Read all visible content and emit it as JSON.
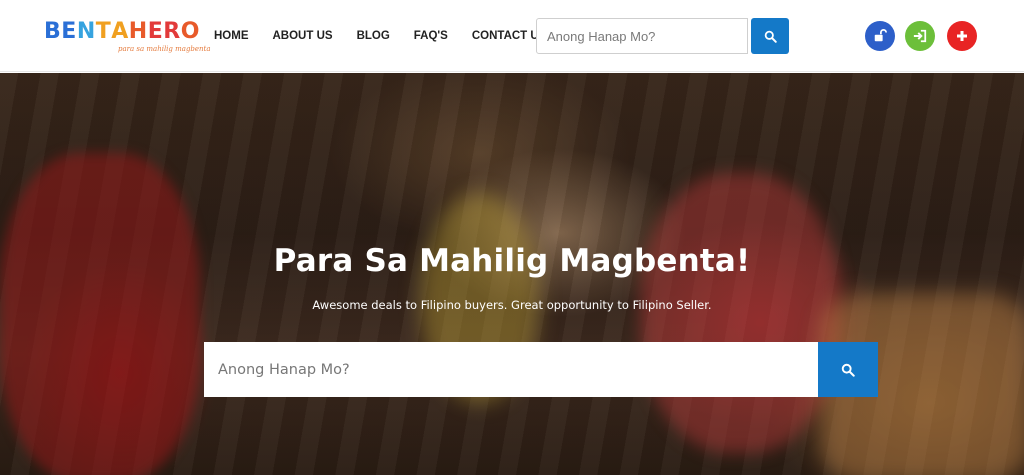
{
  "brand": {
    "name_part1": "BENTA",
    "name_part2": "HERO",
    "tagline": "para sa mahilig magbenta",
    "colors": [
      "#2a6fd6",
      "#36a3df",
      "#f0a020",
      "#e85a2a",
      "#e23a3a",
      "#a040c0",
      "#3fb04f"
    ]
  },
  "nav": {
    "items": [
      {
        "label": "HOME"
      },
      {
        "label": "ABOUT US"
      },
      {
        "label": "BLOG"
      },
      {
        "label": "FAQ'S"
      },
      {
        "label": "CONTACT US"
      }
    ]
  },
  "header_search": {
    "placeholder": "Anong Hanap Mo?",
    "button_icon": "search-icon",
    "button_color": "#1479c8"
  },
  "header_actions": [
    {
      "icon": "unlock-icon",
      "color": "#2d5fc9"
    },
    {
      "icon": "sign-in-icon",
      "color": "#6cbf3a"
    },
    {
      "icon": "plus-icon",
      "color": "#e82424"
    }
  ],
  "hero": {
    "title": "Para Sa Mahilig Magbenta!",
    "subtitle": "Awesome deals to Filipino buyers. Great opportunity to Filipino Seller.",
    "search_placeholder": "Anong Hanap Mo?",
    "search_button_icon": "search-icon"
  }
}
